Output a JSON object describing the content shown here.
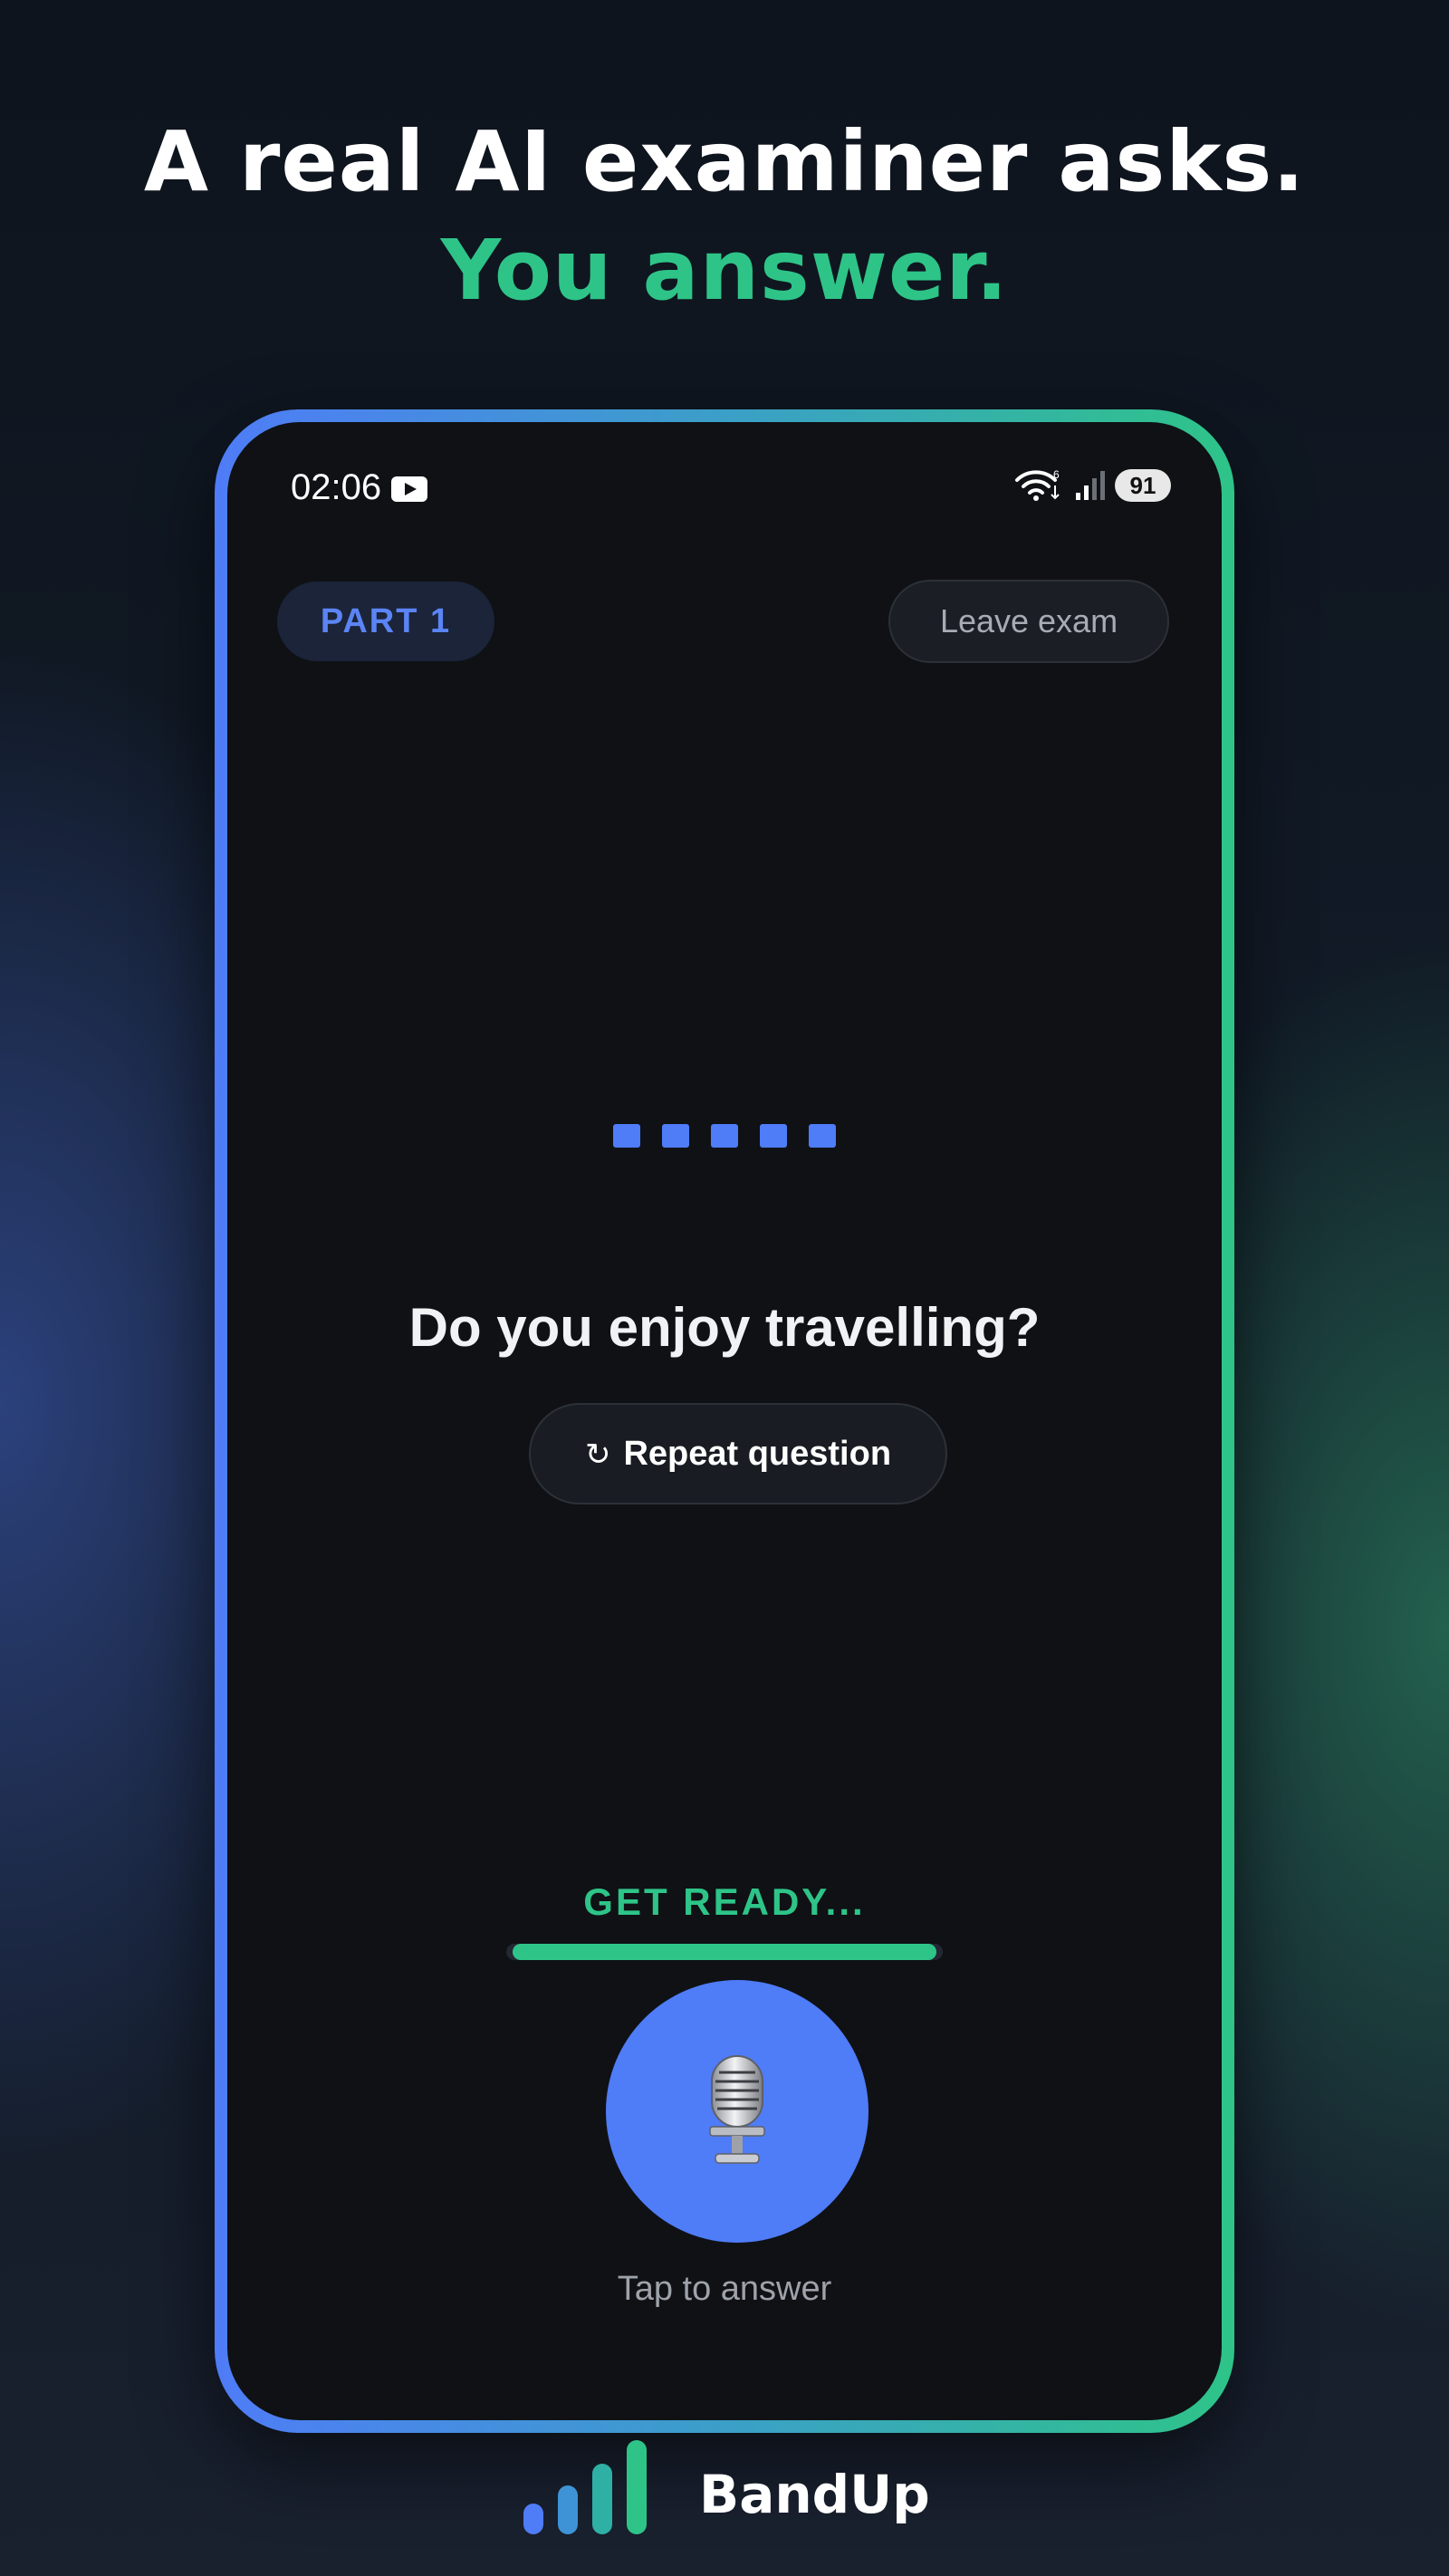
{
  "headline": {
    "line1": "A real AI examiner asks.",
    "line2": "You answer."
  },
  "status_bar": {
    "time": "02:06",
    "battery": "91",
    "icons": [
      "youtube-icon",
      "wifi-icon",
      "signal-icon",
      "battery-icon"
    ]
  },
  "exam": {
    "part_label": "PART 1",
    "leave_label": "Leave exam",
    "question": "Do you enjoy travelling?",
    "repeat_label": "Repeat question",
    "ready_label": "GET READY...",
    "progress": 0.97,
    "mic_label": "Tap to answer"
  },
  "brand": {
    "name": "BandUp"
  },
  "colors": {
    "accent_blue": "#4f7cf7",
    "accent_green": "#2ec488",
    "screen_bg": "#0f1115"
  }
}
